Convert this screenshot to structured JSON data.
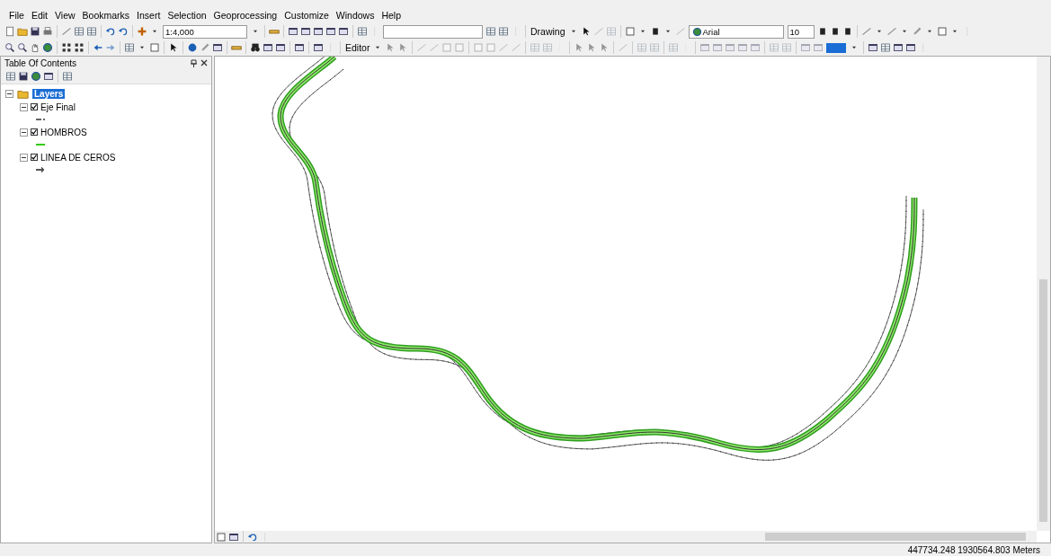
{
  "menu": [
    "File",
    "Edit",
    "View",
    "Bookmarks",
    "Insert",
    "Selection",
    "Geoprocessing",
    "Customize",
    "Windows",
    "Help"
  ],
  "toolbar": {
    "scale": "1:4,000",
    "drawing_label": "Drawing",
    "font": "Arial",
    "font_size": "10",
    "editor_label": "Editor"
  },
  "toc": {
    "title": "Table Of Contents",
    "root": {
      "label": "Layers",
      "selected": true,
      "expanded": true,
      "children": [
        {
          "label": "Eje Final",
          "checked": true,
          "expanded": true,
          "symbol": {
            "kind": "dash",
            "color": "#666666"
          }
        },
        {
          "label": "HOMBROS",
          "checked": true,
          "expanded": true,
          "symbol": {
            "kind": "line",
            "color": "#33cc00"
          }
        },
        {
          "label": "LINEA DE CEROS",
          "checked": true,
          "expanded": true,
          "symbol": {
            "kind": "arrow",
            "color": "#555555"
          }
        }
      ]
    }
  },
  "status_bar": {
    "coordinates": "447734.248  1930564.803 Meters"
  }
}
